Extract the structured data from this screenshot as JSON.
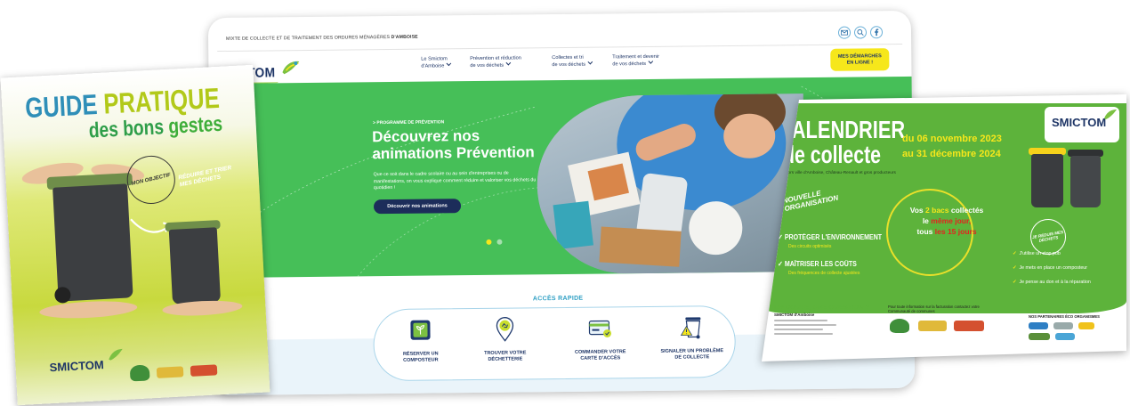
{
  "site": {
    "topbar": {
      "org": "MIXTE DE COLLECTE ET DE TRAITEMENT DES ORDURES MÉNAGÈRES",
      "org_bold": "D'AMBOISE",
      "icons": [
        "mail-icon",
        "search-icon",
        "facebook-icon"
      ]
    },
    "logo": "SMICTOM",
    "nav": [
      {
        "l1": "Le Smictom",
        "l2": "d'Amboise"
      },
      {
        "l1": "Prévention et réduction",
        "l2": "de vos déchets"
      },
      {
        "l1": "Collectes et tri",
        "l2": "de vos déchets"
      },
      {
        "l1": "Traitement et devenir",
        "l2": "de vos déchets"
      }
    ],
    "cta": {
      "l1": "MES DÉMARCHES",
      "l2": "EN LIGNE !"
    },
    "hero": {
      "kicker": "> PROGRAMME DE PRÉVENTION",
      "title": "Découvrez nos animations Prévention",
      "text": "Que ce soit dans le cadre scolaire ou au sein d'entreprises ou de manifestations, on vous explique comment réduire et valoriser vos déchets du quotidien !",
      "button": "Découvrir nos animations"
    },
    "quick": {
      "title": "ACCÈS RAPIDE",
      "items": [
        {
          "l1": "RÉSERVER UN",
          "l2": "COMPOSTEUR",
          "icon": "composter-icon"
        },
        {
          "l1": "TROUVER VOTRE",
          "l2": "DÉCHETTERIE",
          "icon": "location-pin-recycle-icon"
        },
        {
          "l1": "COMMANDER VOTRE",
          "l2": "CARTE D'ACCÈS",
          "icon": "access-card-icon"
        },
        {
          "l1": "SIGNALER UN PROBLÈME",
          "l2": "DE COLLECTE",
          "icon": "bin-warning-icon"
        }
      ]
    }
  },
  "guide": {
    "title_a": "GUIDE",
    "title_b": "PRATIQUE",
    "sub_a": "des bons",
    "sub_b": "gestes",
    "badge": "MON OBJECTIF",
    "goal": "RÉDUIRE ET TRIER MES DÉCHETS",
    "logo": "SMICTOM"
  },
  "calendar": {
    "title_a": "CALENDRIER",
    "title_b": "de collecte",
    "date_from": "du 06 novembre 2023",
    "date_to": "au 31 décembre 2024",
    "scope": "Hors ville d'Amboise, Château-Renault et gros producteurs",
    "new_org": "NOUVELLE ORGANISATION",
    "bacs": {
      "vos": "Vos",
      "two_bins": "2 bacs",
      "collected": "collectés",
      "le": "le",
      "same_day": "même jour,",
      "tous": "tous",
      "every_15": "les 15 jours"
    },
    "goals": [
      {
        "title": "✓ PROTÉGER L'ENVIRONNEMENT",
        "sub": "Des circuits optimisés"
      },
      {
        "title": "✓ MAÎTRISER LES COÛTS",
        "sub": "Des fréquences de collecte ajustées"
      }
    ],
    "reduce": "JE RÉDUIS MES DÉCHETS",
    "tips": [
      "J'utilise un stop pub",
      "Je mets en place un composteur",
      "Je pense au don et à la réparation"
    ],
    "question": "UN DOUTE, UNE QUESTION ?",
    "contact": "SMICTOM d'Amboise",
    "info": "Pour toute information sur la facturation contactez votre Communauté de communes",
    "partners": "NOS PARTENAIRES ÉCO ORGANISMES",
    "logo": "SMICTOM"
  },
  "colors": {
    "hero_green": "#46bf58",
    "navy": "#1e3566",
    "cta_yellow": "#f6e71b",
    "accent_blue": "#2e9fc4",
    "guide_teal": "#2f8fb8",
    "guide_lime": "#b2c91a",
    "guide_green": "#2f9e49",
    "cal_green": "#5db33b",
    "cal_yellow": "#f6e71b",
    "cal_red": "#e4231f"
  }
}
